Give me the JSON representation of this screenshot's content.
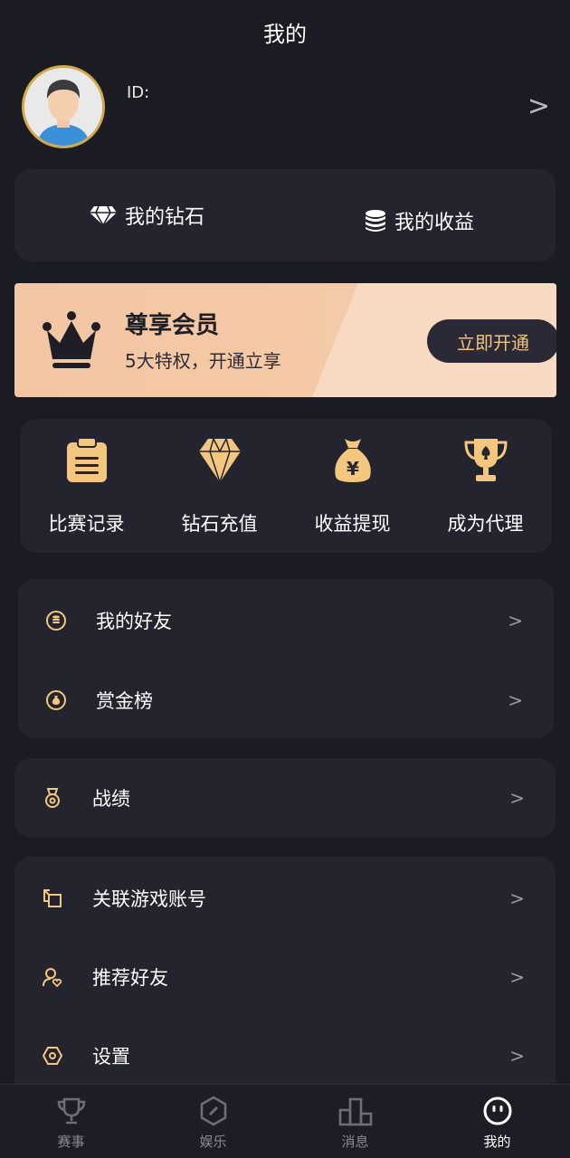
{
  "header": {
    "title": "我的"
  },
  "profile": {
    "id_label": "ID:",
    "arrow": ">"
  },
  "wallet": {
    "diamonds_label": "我的钻石",
    "earnings_label": "我的收益"
  },
  "vip": {
    "title": "尊享会员",
    "subtitle": "5大特权，开通立享",
    "button": "立即开通"
  },
  "quick_actions": [
    {
      "label": "比赛记录",
      "icon": "clipboard-icon"
    },
    {
      "label": "钻石充值",
      "icon": "diamond-icon"
    },
    {
      "label": "收益提现",
      "icon": "money-bag-icon"
    },
    {
      "label": "成为代理",
      "icon": "trophy-icon"
    }
  ],
  "menu_group1": [
    {
      "label": "我的好友",
      "icon": "coin-icon"
    },
    {
      "label": "赏金榜",
      "icon": "bounty-icon"
    }
  ],
  "menu_group2": [
    {
      "label": "战绩",
      "icon": "medal-icon"
    }
  ],
  "menu_group3": [
    {
      "label": "关联游戏账号",
      "icon": "link-icon"
    },
    {
      "label": "推荐好友",
      "icon": "user-heart-icon"
    },
    {
      "label": "设置",
      "icon": "settings-icon"
    }
  ],
  "menu_arrow": ">",
  "tabs": [
    {
      "label": "赛事",
      "icon": "trophy-icon"
    },
    {
      "label": "娱乐",
      "icon": "hexagon-icon"
    },
    {
      "label": "消息",
      "icon": "podium-icon"
    },
    {
      "label": "我的",
      "icon": "face-icon"
    }
  ],
  "colors": {
    "accent": "#f0c27f",
    "background": "#1b1b23",
    "card": "#24242e",
    "vip_bg": "#f3c6a3"
  }
}
